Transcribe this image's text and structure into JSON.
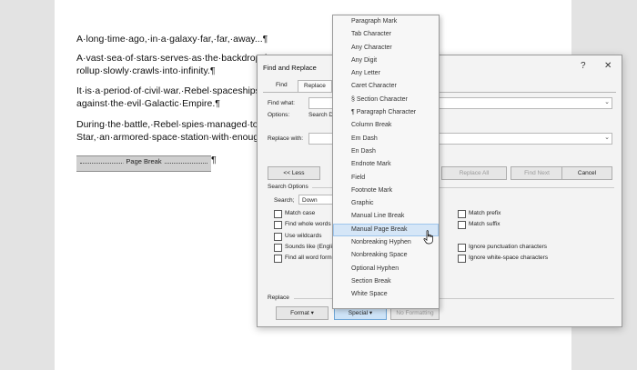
{
  "document": {
    "lines": [
      "A·long·time·ago,·in·a·galaxy·far,·far,·away...¶",
      "A·vast·sea·of·stars·serves·as·the·backdrop·fo",
      "rollup·slowly·crawls·into·infinity.¶",
      "It·is·a·period·of·civil·war.·Rebel·spaceships,·s",
      "against·the·evil·Galactic·Empire.¶",
      "During·the·battle,·Rebel·spies·managed·to·st",
      "Star,·an·armored·space·station·with·enough·"
    ],
    "page_break_label": "Page Break",
    "page_break_pilcrow": "¶"
  },
  "dialog": {
    "title": "Find and Replace",
    "help": "?",
    "close": "✕",
    "tabs": [
      "Find",
      "Replace"
    ],
    "find_label": "Find what:",
    "options_label": "Options:",
    "options_value": "Search D",
    "replace_label": "Replace with:",
    "less_button": "<< Less",
    "replace_all_button": "Replace All",
    "find_next_button": "Find Next",
    "cancel_button": "Cancel",
    "search_options_label": "Search Options",
    "search_label": "Search;",
    "search_value": "Down",
    "left_checks": [
      "Match case",
      "Find whole words",
      "Use wildcards",
      "Sounds like (Englis",
      "Find all word form"
    ],
    "right_checks": [
      "Match prefix",
      "Match suffix",
      "Ignore punctuation characters",
      "Ignore white-space characters"
    ],
    "replace_section_label": "Replace",
    "format_button": "Format ▾",
    "special_button": "Special ▾",
    "no_formatting_button": "No Formatting"
  },
  "special_menu": {
    "items": [
      "Paragraph Mark",
      "Tab Character",
      "Any Character",
      "Any Digit",
      "Any Letter",
      "Caret Character",
      "§ Section Character",
      "¶ Paragraph Character",
      "Column Break",
      "Em Dash",
      "En Dash",
      "Endnote Mark",
      "Field",
      "Footnote Mark",
      "Graphic",
      "Manual Line Break",
      "Manual Page Break",
      "Nonbreaking Hyphen",
      "Nonbreaking Space",
      "Optional Hyphen",
      "Section Break",
      "White Space"
    ],
    "highlighted": "Manual Page Break"
  }
}
